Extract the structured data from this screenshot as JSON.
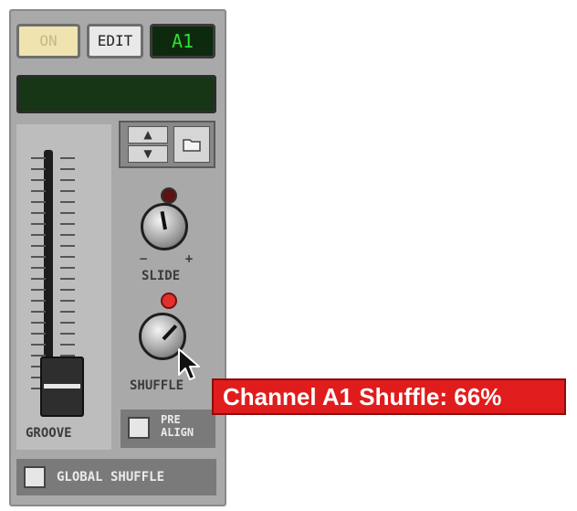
{
  "header": {
    "on_label": "ON",
    "edit_label": "EDIT",
    "patch_display": "A1",
    "name_display": ""
  },
  "controls": {
    "slide_label": "SLIDE",
    "shuffle_label": "SHUFFLE",
    "groove_label": "GROOVE",
    "prealign_label_line1": "PRE",
    "prealign_label_line2": "ALIGN",
    "global_shuffle_label": "GLOBAL SHUFFLE",
    "knob_min_symbol": "−",
    "knob_max_symbol": "+"
  },
  "state": {
    "shuffle_percent": 66,
    "prealign_checked": false,
    "global_shuffle_checked": false
  },
  "tooltip": {
    "text": "Channel A1 Shuffle: 66%"
  },
  "colors": {
    "tooltip_bg": "#e11c1c",
    "lcd_green": "#2fe02f",
    "led_active": "#e03030"
  },
  "icons": {
    "up": "arrow-up-icon",
    "down": "arrow-down-icon",
    "folder": "folder-icon",
    "cursor": "mouse-pointer-icon"
  }
}
